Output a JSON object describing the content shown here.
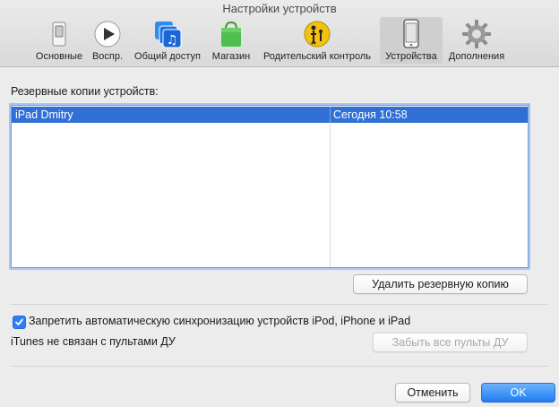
{
  "window": {
    "title": "Настройки устройств"
  },
  "toolbar": {
    "tabs": [
      {
        "label": "Основные",
        "icon": "general-switch-icon"
      },
      {
        "label": "Воспр.",
        "icon": "play-icon"
      },
      {
        "label": "Общий доступ",
        "icon": "shared-music-icon"
      },
      {
        "label": "Магазин",
        "icon": "store-bag-icon"
      },
      {
        "label": "Родительский контроль",
        "icon": "parental-control-icon"
      },
      {
        "label": "Устройства",
        "icon": "iphone-icon"
      },
      {
        "label": "Дополнения",
        "icon": "gear-icon"
      }
    ],
    "selected_tab": "Устройства"
  },
  "backups": {
    "label": "Резервные копии устройств:",
    "rows": [
      {
        "name": "iPad Dmitry",
        "date": "Сегодня 10:58",
        "selected": true
      }
    ],
    "delete_button": "Удалить резервную копию"
  },
  "sync": {
    "prevent_auto_sync_label": "Запретить автоматическую синхронизацию устройств iPod, iPhone и iPad",
    "checked": true
  },
  "remotes": {
    "status": "iTunes не связан с пультами ДУ",
    "forget_button": "Забыть все пульты ДУ"
  },
  "footer": {
    "cancel": "Отменить",
    "ok": "OK"
  },
  "colors": {
    "selection": "#2f6fd6",
    "accent": "#1e7cf2"
  }
}
